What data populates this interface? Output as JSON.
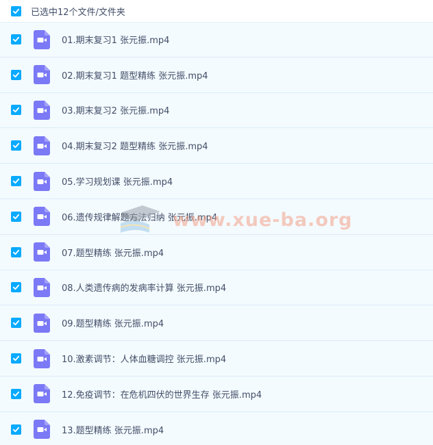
{
  "header": {
    "select_all_label": "已选中12个文件/文件夹",
    "checked": true
  },
  "files": [
    {
      "name": "01.期末复习1 张元振.mp4",
      "checked": true
    },
    {
      "name": "02.期末复习1 题型精练 张元振.mp4",
      "checked": true
    },
    {
      "name": "03.期末复习2 张元振.mp4",
      "checked": true
    },
    {
      "name": "04.期末复习2 题型精练 张元振.mp4",
      "checked": true
    },
    {
      "name": "05.学习规划课 张元振.mp4",
      "checked": true
    },
    {
      "name": "06.遗传规律解题方法归纳 张元振.mp4",
      "checked": true
    },
    {
      "name": "07.题型精练 张元振.mp4",
      "checked": true
    },
    {
      "name": "08.人类遗传病的发病率计算 张元振.mp4",
      "checked": true
    },
    {
      "name": "09.题型精练 张元振.mp4",
      "checked": true
    },
    {
      "name": "10.激素调节：人体血糖调控 张元振.mp4",
      "checked": true
    },
    {
      "name": "12.免疫调节：在危机四伏的世界生存 张元振.mp4",
      "checked": true
    },
    {
      "name": "13.题型精练 张元振.mp4",
      "checked": true
    }
  ],
  "watermark": {
    "text": "www.xue-ba.org"
  },
  "colors": {
    "checkbox": "#09aaff",
    "video_icon": "#7b79f5",
    "row_background": "#f4fbff",
    "text": "#424e67"
  },
  "icons": {
    "checkbox": "check-icon",
    "file": "video-file-icon"
  }
}
